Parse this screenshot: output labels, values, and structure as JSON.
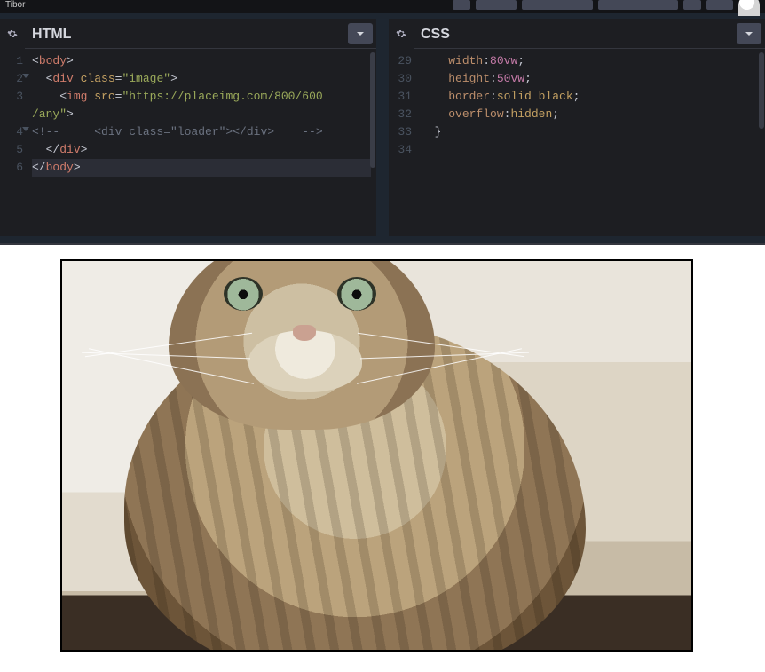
{
  "topbar": {
    "username": "Tibor"
  },
  "panels": {
    "html": {
      "title": "HTML",
      "lines": [
        {
          "n": "1",
          "fold": false,
          "segs": [
            {
              "t": "<",
              "c": "t-punc"
            },
            {
              "t": "body",
              "c": "t-tag"
            },
            {
              "t": ">",
              "c": "t-punc"
            }
          ]
        },
        {
          "n": "2",
          "fold": true,
          "segs": [
            {
              "t": "  <",
              "c": "t-punc"
            },
            {
              "t": "div",
              "c": "t-tag"
            },
            {
              "t": " ",
              "c": ""
            },
            {
              "t": "class",
              "c": "t-attr"
            },
            {
              "t": "=",
              "c": "t-punc"
            },
            {
              "t": "\"image\"",
              "c": "t-str"
            },
            {
              "t": ">",
              "c": "t-punc"
            }
          ]
        },
        {
          "n": "3",
          "fold": false,
          "segs": [
            {
              "t": "    <",
              "c": "t-punc"
            },
            {
              "t": "img",
              "c": "t-tag"
            },
            {
              "t": " ",
              "c": ""
            },
            {
              "t": "src",
              "c": "t-attr"
            },
            {
              "t": "=",
              "c": "t-punc"
            },
            {
              "t": "\"https://placeimg.com/800/600",
              "c": "t-str"
            }
          ]
        },
        {
          "n": "",
          "fold": false,
          "segs": [
            {
              "t": "/any\"",
              "c": "t-str"
            },
            {
              "t": ">",
              "c": "t-punc"
            }
          ]
        },
        {
          "n": "4",
          "fold": true,
          "segs": [
            {
              "t": "<!--     <div class=\"loader\"></div>    -->",
              "c": "t-cmt"
            }
          ]
        },
        {
          "n": "5",
          "fold": false,
          "segs": [
            {
              "t": "  </",
              "c": "t-punc"
            },
            {
              "t": "div",
              "c": "t-tag"
            },
            {
              "t": ">",
              "c": "t-punc"
            }
          ]
        },
        {
          "n": "6",
          "fold": false,
          "hl": true,
          "segs": [
            {
              "t": "</",
              "c": "t-punc"
            },
            {
              "t": "body",
              "c": "t-tag"
            },
            {
              "t": ">",
              "c": "t-punc"
            }
          ]
        }
      ]
    },
    "css": {
      "title": "CSS",
      "lines": [
        {
          "n": "29",
          "segs": [
            {
              "t": "    ",
              "c": ""
            },
            {
              "t": "width",
              "c": "t-prop"
            },
            {
              "t": ":",
              "c": "t-punc"
            },
            {
              "t": "80vw",
              "c": "t-num"
            },
            {
              "t": ";",
              "c": "t-punc"
            }
          ]
        },
        {
          "n": "30",
          "segs": [
            {
              "t": "    ",
              "c": ""
            },
            {
              "t": "height",
              "c": "t-prop"
            },
            {
              "t": ":",
              "c": "t-punc"
            },
            {
              "t": "50vw",
              "c": "t-num"
            },
            {
              "t": ";",
              "c": "t-punc"
            }
          ]
        },
        {
          "n": "31",
          "segs": [
            {
              "t": "    ",
              "c": ""
            },
            {
              "t": "border",
              "c": "t-prop"
            },
            {
              "t": ":",
              "c": "t-punc"
            },
            {
              "t": "solid black",
              "c": "t-val"
            },
            {
              "t": ";",
              "c": "t-punc"
            }
          ]
        },
        {
          "n": "32",
          "segs": [
            {
              "t": "    ",
              "c": ""
            },
            {
              "t": "overflow",
              "c": "t-prop"
            },
            {
              "t": ":",
              "c": "t-punc"
            },
            {
              "t": "hidden",
              "c": "t-val"
            },
            {
              "t": ";",
              "c": "t-punc"
            }
          ]
        },
        {
          "n": "33",
          "segs": [
            {
              "t": "  }",
              "c": "t-punc"
            }
          ]
        },
        {
          "n": "34",
          "segs": []
        }
      ]
    }
  }
}
